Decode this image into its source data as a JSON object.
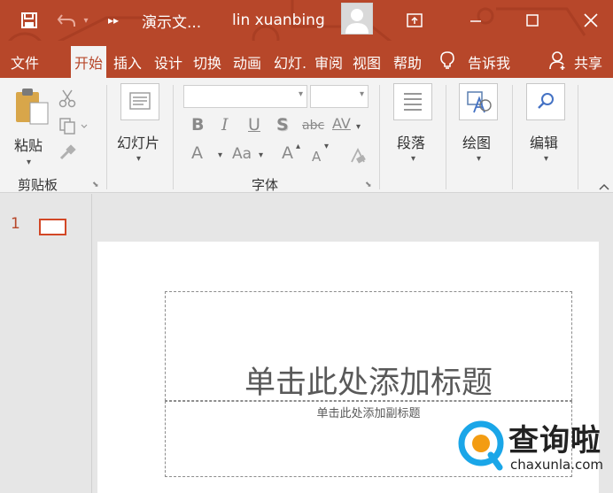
{
  "window": {
    "doc_title": "演示文...",
    "user_name": "lin xuanbing"
  },
  "tabs": [
    "文件",
    "开始",
    "插入",
    "设计",
    "切换",
    "动画",
    "幻灯.",
    "审阅",
    "视图",
    "帮助"
  ],
  "tell_me": "告诉我",
  "share": "共享",
  "ribbon": {
    "clipboard": {
      "paste": "粘贴",
      "group": "剪贴板"
    },
    "slides": {
      "new_slide": "幻灯片"
    },
    "font": {
      "group": "字体",
      "bold": "B",
      "italic": "I",
      "underline": "U",
      "shadow": "S",
      "strike": "abc",
      "spacing": "AV",
      "font_color": "A",
      "case": "Aa",
      "grow": "A",
      "shrink": "A"
    },
    "paragraph": "段落",
    "drawing": "绘图",
    "editing": "编辑"
  },
  "slides_pane": {
    "slide_number": "1"
  },
  "slide": {
    "title_placeholder": "单击此处添加标题",
    "subtitle_placeholder": "单击此处添加副标题"
  },
  "watermark": {
    "brand": "查询啦",
    "url": "chaxunla.com"
  },
  "colors": {
    "accent": "#b7472a",
    "ribbon_bg": "#f3f3f3",
    "workspace_bg": "#e6e6e6"
  },
  "icons": [
    "save-icon",
    "undo-icon",
    "quick-access-more-icon",
    "ribbon-display-icon",
    "minimize-icon",
    "maximize-icon",
    "close-icon",
    "lightbulb-icon",
    "share-person-icon",
    "paste-icon",
    "cut-icon",
    "copy-icon",
    "format-painter-icon",
    "new-slide-icon",
    "paragraph-icon",
    "drawing-icon",
    "search-icon",
    "collapse-ribbon-icon"
  ]
}
